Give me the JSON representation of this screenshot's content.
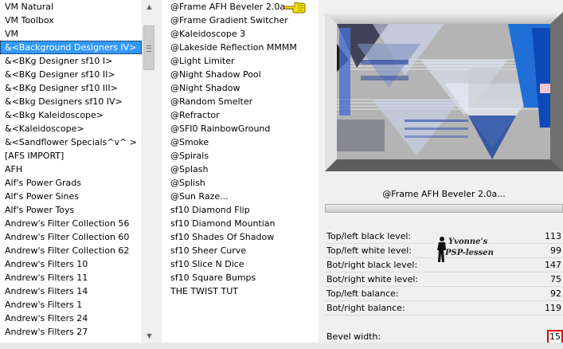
{
  "categories": {
    "items": [
      "VM Natural",
      "VM Toolbox",
      "VM",
      "&<Background Designers IV>",
      "&<BKg Designer sf10 I>",
      "&<BKg Designer sf10 II>",
      "&<BKg Designer sf10 III>",
      "&<Bkg Designers sf10 IV>",
      "&<Bkg Kaleidoscope>",
      "&<Kaleidoscope>",
      "&<Sandflower Specials^v^ >",
      "[AFS IMPORT]",
      "AFH",
      "Alf's Power Grads",
      "Alf's Power Sines",
      "Alf's Power Toys",
      "Andrew's Filter Collection 56",
      "Andrew's Filter Collection 60",
      "Andrew's Filter Collection 62",
      "Andrew's Filters 10",
      "Andrew's Filters 11",
      "Andrew's Filters 14",
      "Andrew's Filters 1",
      "Andrew's Filters 24",
      "Andrew's Filters 27"
    ],
    "selected_index": 3
  },
  "filters": {
    "items": [
      "@Frame AFH Beveler 2.0a...",
      "@Frame Gradient Switcher",
      "@Kaleidoscope 3",
      "@Lakeside Reflection MMMM",
      "@Light Limiter",
      "@Night Shadow Pool",
      "@Night Shadow",
      "@Random Smelter",
      "@Refractor",
      "@SFI0 RainbowGround",
      "@Smoke",
      "@Spirals",
      "@Splash",
      "@Splish",
      "@Sun Raze...",
      "sf10 Diamond Flip",
      "sf10 Diamond Mountian",
      "sf10 Shades Of Shadow",
      "sf10 Sheer Curve",
      "sf10 Slice N Dice",
      "sf10 Square Bumps",
      "THE TWIST TUT"
    ],
    "pointer_icon": "pointing-hand-icon"
  },
  "filter_title": "@Frame AFH Beveler 2.0a...",
  "parameters": [
    {
      "label": "Top/left black level:",
      "value": "113"
    },
    {
      "label": "Top/left white level:",
      "value": "99"
    },
    {
      "label": "Bot/right black level:",
      "value": "147"
    },
    {
      "label": "Bot/right white level:",
      "value": "75"
    },
    {
      "label": "Top/left balance:",
      "value": "92"
    },
    {
      "label": "Bot/right balance:",
      "value": "119"
    }
  ],
  "bevel": {
    "label": "Bevel width:",
    "value": "15"
  },
  "watermark": {
    "line1": "Yvonne's",
    "line2": "PSP-lessen"
  },
  "colors": {
    "selection": "#3399ff",
    "highlight_border": "#e00000",
    "preview_blue": "#1f6fd6"
  }
}
